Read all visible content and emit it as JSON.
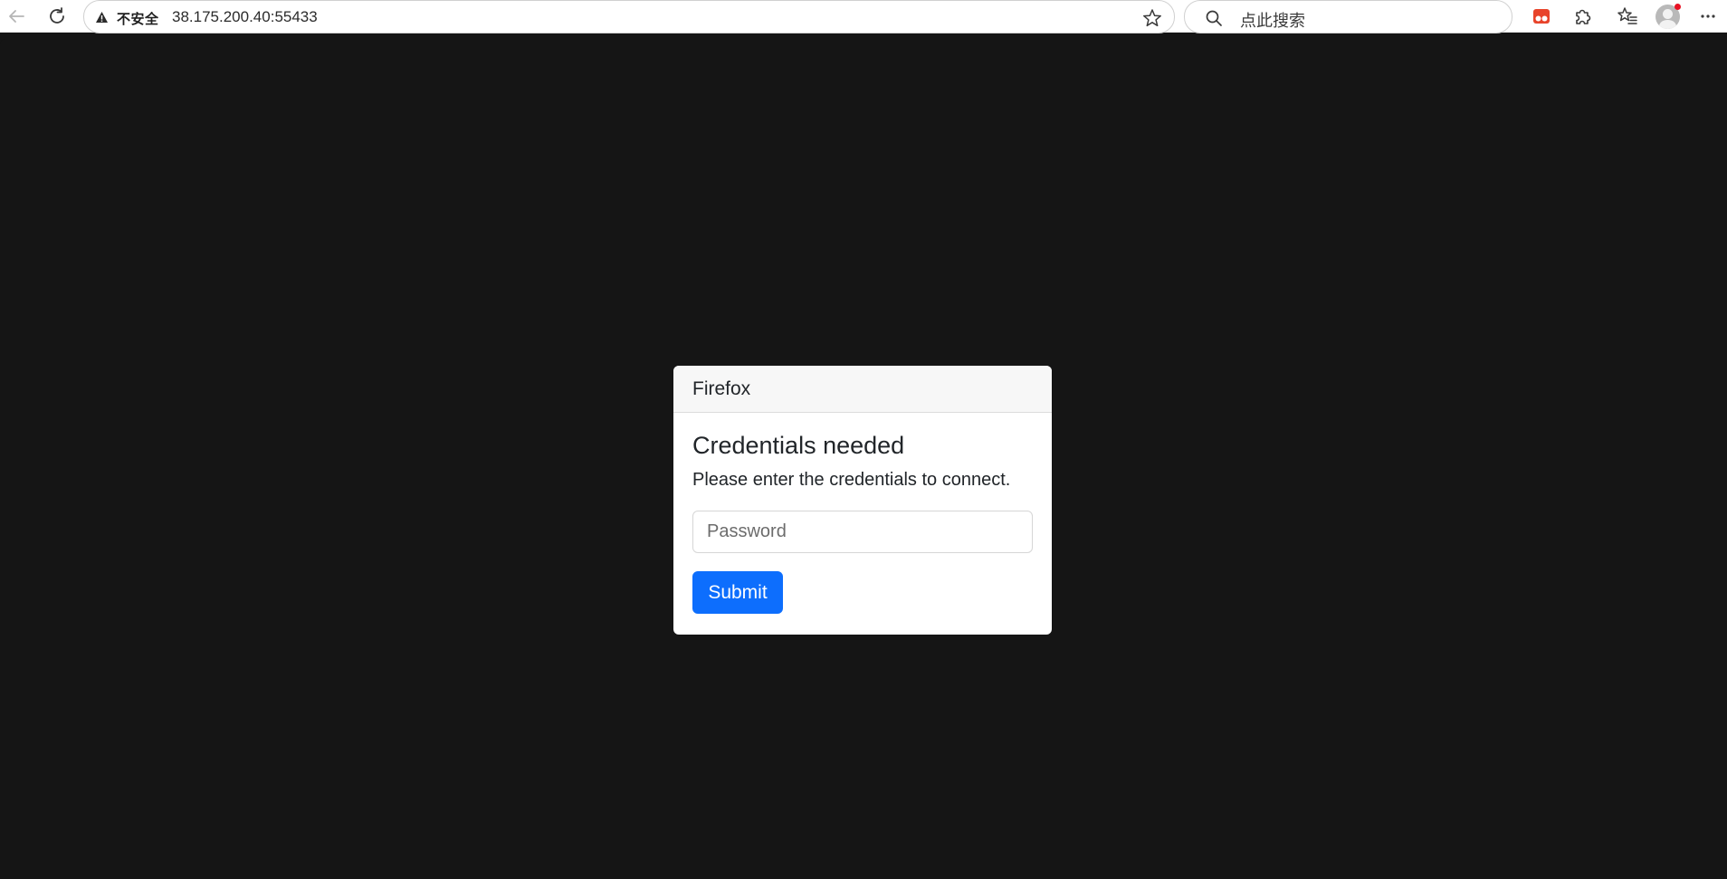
{
  "browser": {
    "security_label": "不安全",
    "url": "38.175.200.40:55433",
    "search_placeholder": "点此搜索",
    "icons": [
      "back-icon",
      "reload-icon",
      "warning-icon",
      "star-icon",
      "search-icon",
      "extension-app-icon",
      "puzzle-icon",
      "favorites-icon",
      "profile-avatar",
      "more-icon"
    ],
    "colors": {
      "notification_dot": "#e81123",
      "extension_red": "#e8442b"
    }
  },
  "dialog": {
    "header": "Firefox",
    "title": "Credentials needed",
    "message": "Please enter the credentials to connect.",
    "password_placeholder": "Password",
    "password_value": "",
    "submit_label": "Submit"
  },
  "colors": {
    "page_background": "#151515",
    "primary_button": "#0d6efd"
  }
}
